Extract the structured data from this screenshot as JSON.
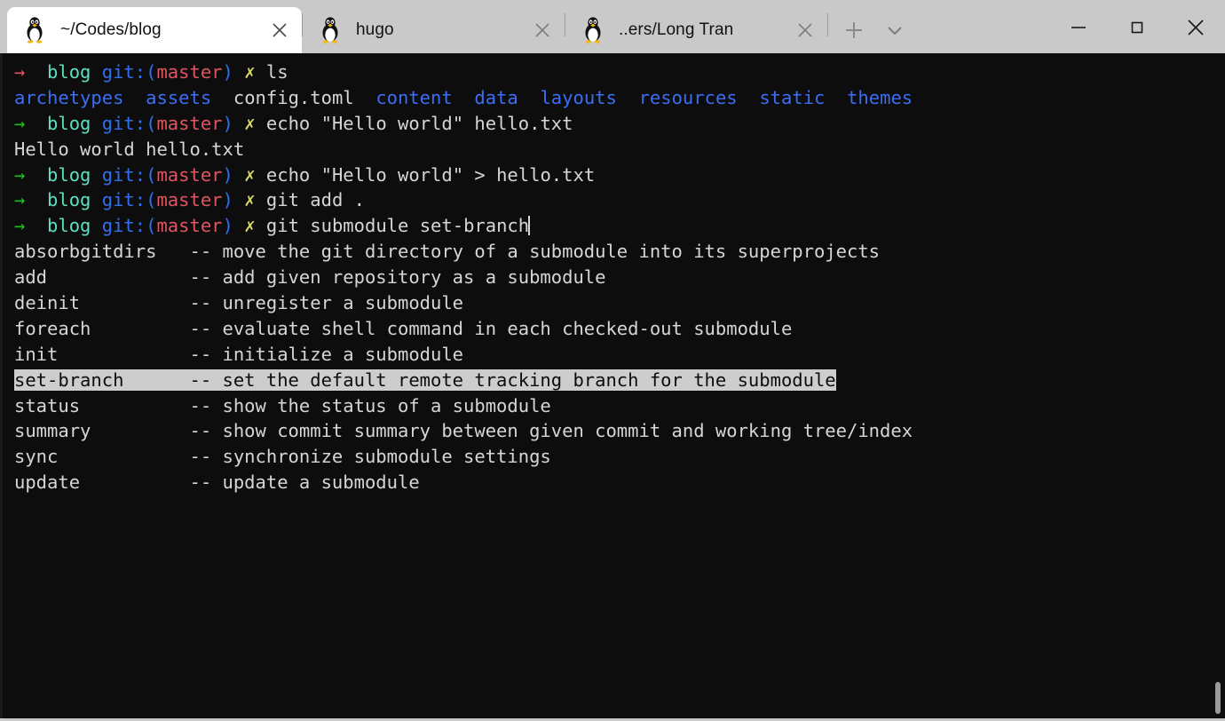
{
  "window": {
    "titlebar_bg": "#c9c9c9",
    "terminal_bg": "#0d0d0d",
    "minimize_label": "Minimize",
    "maximize_label": "Maximize",
    "close_label": "Close"
  },
  "tabs": [
    {
      "title": "~/Codes/blog",
      "icon": "tux-icon",
      "active": true,
      "close_label": "Close tab"
    },
    {
      "title": "hugo",
      "icon": "tux-icon",
      "active": false,
      "close_label": "Close tab"
    },
    {
      "title": "..ers/Long Tran",
      "icon": "tux-icon",
      "active": false,
      "close_label": "Close tab"
    }
  ],
  "tabbar": {
    "new_tab_label": "New tab",
    "new_tab_icon": "plus-icon",
    "dropdown_label": "Open new tab dropdown",
    "dropdown_icon": "chevron-down-icon"
  },
  "terminal": {
    "prompt": {
      "dir": "blog",
      "git_prefix": "git:(",
      "branch": "master",
      "git_suffix": ")",
      "status_mark": "✗",
      "arrow": "→"
    },
    "colors": {
      "arrow_ok": "#1fc31f",
      "arrow_error": "#e05561",
      "dir": "#5ce0c0",
      "git": "#2f6ff0",
      "branch": "#e05561",
      "status_mark": "#d8d86a",
      "text": "#d6d6d6",
      "directory_listing": "#3b6ef5",
      "selection_bg": "#cdcdcd",
      "selection_fg": "#0d0d0d"
    },
    "lines": [
      {
        "type": "prompt",
        "arrow_state": "error",
        "command": "ls"
      },
      {
        "type": "ls_output",
        "entries": [
          {
            "name": "archetypes",
            "kind": "dir"
          },
          {
            "name": "assets",
            "kind": "dir"
          },
          {
            "name": "config.toml",
            "kind": "file"
          },
          {
            "name": "content",
            "kind": "dir"
          },
          {
            "name": "data",
            "kind": "dir"
          },
          {
            "name": "layouts",
            "kind": "dir"
          },
          {
            "name": "resources",
            "kind": "dir"
          },
          {
            "name": "static",
            "kind": "dir"
          },
          {
            "name": "themes",
            "kind": "dir"
          }
        ]
      },
      {
        "type": "prompt",
        "arrow_state": "ok",
        "command": "echo \"Hello world\" hello.txt"
      },
      {
        "type": "output",
        "text": "Hello world hello.txt"
      },
      {
        "type": "prompt",
        "arrow_state": "ok",
        "command": "echo \"Hello world\" > hello.txt"
      },
      {
        "type": "prompt",
        "arrow_state": "ok",
        "command": "git add ."
      },
      {
        "type": "prompt",
        "arrow_state": "ok",
        "command": "git submodule set-branch",
        "cursor": true
      }
    ],
    "completion": {
      "separator": "--",
      "selected_index": 5,
      "items": [
        {
          "name": "absorbgitdirs",
          "desc": "move the git directory of a submodule into its superprojects"
        },
        {
          "name": "add",
          "desc": "add given repository as a submodule"
        },
        {
          "name": "deinit",
          "desc": "unregister a submodule"
        },
        {
          "name": "foreach",
          "desc": "evaluate shell command in each checked-out submodule"
        },
        {
          "name": "init",
          "desc": "initialize a submodule"
        },
        {
          "name": "set-branch",
          "desc": "set the default remote tracking branch for the submodule"
        },
        {
          "name": "status",
          "desc": "show the status of a submodule"
        },
        {
          "name": "summary",
          "desc": "show commit summary between given commit and working tree/index"
        },
        {
          "name": "sync",
          "desc": "synchronize submodule settings"
        },
        {
          "name": "update",
          "desc": "update a submodule"
        }
      ]
    },
    "scrollbar": {
      "name": "vertical-scrollbar"
    }
  }
}
